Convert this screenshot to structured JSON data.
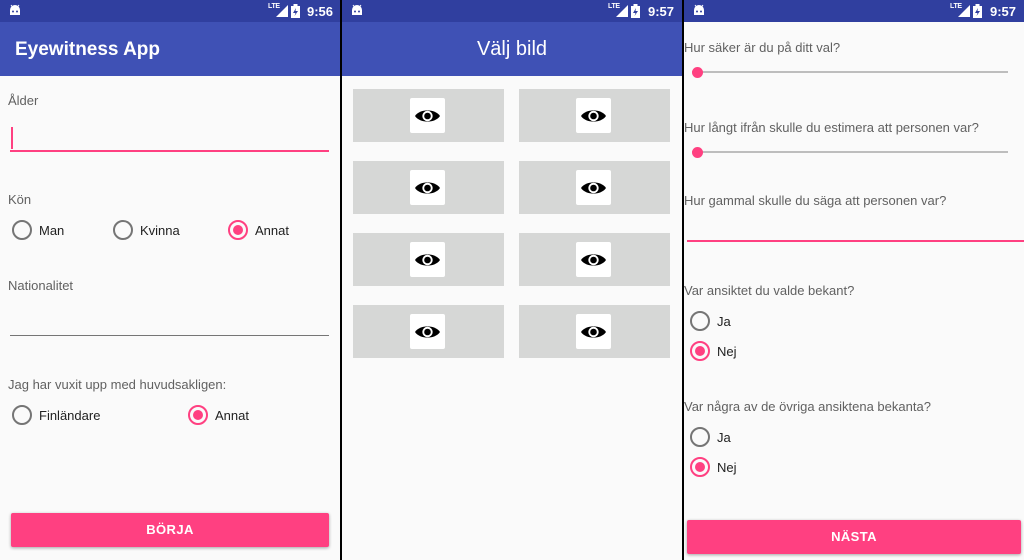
{
  "screens": {
    "registration": {
      "status": {
        "network": "LTE",
        "time": "9:56"
      },
      "app_title": "Eyewitness App",
      "age_label": "Ålder",
      "age_value": "",
      "gender_label": "Kön",
      "gender_options": [
        "Man",
        "Kvinna",
        "Annat"
      ],
      "gender_selected": "Annat",
      "nationality_label": "Nationalitet",
      "nationality_value": "",
      "upbringing_label": "Jag har vuxit upp med huvudsakligen:",
      "upbringing_options": [
        "Finländare",
        "Annat"
      ],
      "upbringing_selected": "Annat",
      "start_button": "BÖRJA"
    },
    "choose_image": {
      "status": {
        "network": "LTE",
        "time": "9:57"
      },
      "title": "Välj bild",
      "tile_icon": "eye-icon",
      "tile_count": 8
    },
    "questions": {
      "status": {
        "network": "LTE",
        "time": "9:57"
      },
      "q_confidence": "Hur säker är du på ditt val?",
      "confidence_level": 0,
      "q_distance": "Hur långt ifrån skulle du estimera att personen var?",
      "distance_level": 0,
      "q_age": "Hur gammal skulle du säga att personen var?",
      "age_value": "",
      "q_familiar": "Var ansiktet du valde bekant?",
      "familiar_options": [
        "Ja",
        "Nej"
      ],
      "familiar_selected": "Nej",
      "q_others_familiar": "Var några av de övriga ansiktena bekanta?",
      "others_options": [
        "Ja",
        "Nej"
      ],
      "others_selected": "Nej",
      "next_button": "NÄSTA"
    }
  },
  "colors": {
    "status_bar": "#303f9f",
    "app_bar": "#3f51b5",
    "accent": "#ff4081",
    "tile_bg": "#d6d7d6",
    "background": "#fafafa"
  }
}
